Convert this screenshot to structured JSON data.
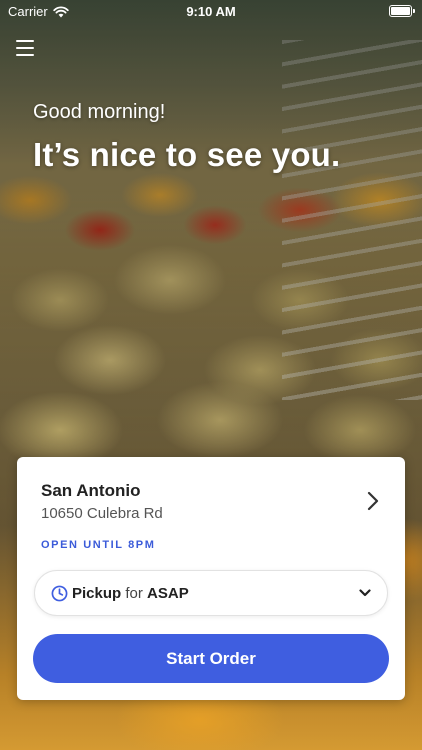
{
  "status_bar": {
    "carrier": "Carrier",
    "time": "9:10 AM"
  },
  "greeting": {
    "subtitle": "Good morning!",
    "title": "It’s nice to see you."
  },
  "store": {
    "name": "San Antonio",
    "address": "10650 Culebra Rd",
    "status": "OPEN UNTIL 8PM"
  },
  "order_method": {
    "mode": "Pickup",
    "connector": "for",
    "time": "ASAP"
  },
  "actions": {
    "start_order": "Start Order"
  },
  "colors": {
    "accent": "#3f5ee0",
    "status_text": "#3b5bd9"
  },
  "icons": {
    "menu": "hamburger-menu-icon",
    "store_link": "chevron-right-icon",
    "time": "clock-icon",
    "dropdown": "chevron-down-icon",
    "wifi": "wifi-icon",
    "battery": "battery-icon"
  }
}
